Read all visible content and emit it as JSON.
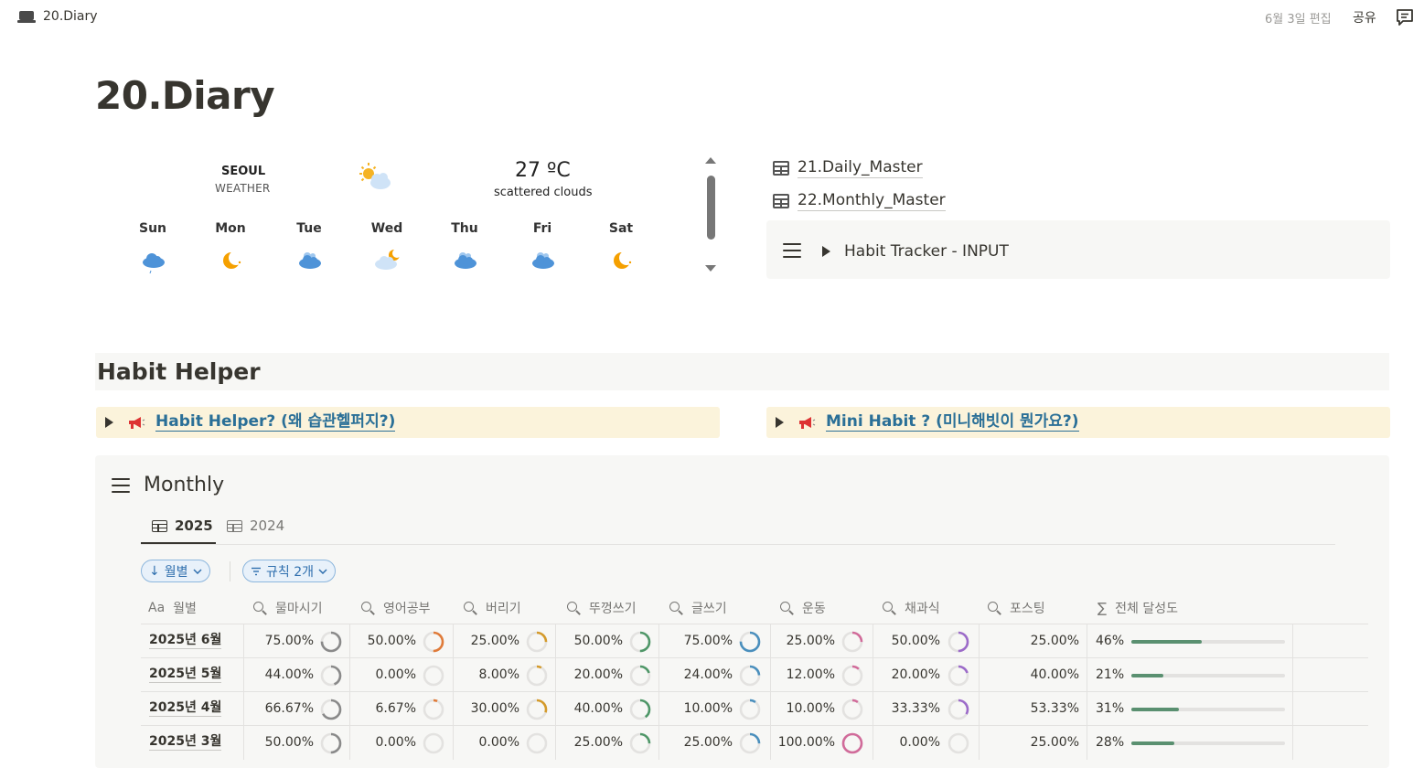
{
  "topbar": {
    "breadcrumb": "20.Diary",
    "edited": "6월 3일 편집",
    "share": "공유"
  },
  "page": {
    "title": "20.Diary"
  },
  "weather": {
    "city": "SEOUL",
    "subtitle": "WEATHER",
    "temp": "27 ºC",
    "desc": "scattered clouds",
    "days": [
      {
        "label": "Sun",
        "icon": "cloud-rain-icon"
      },
      {
        "label": "Mon",
        "icon": "moon-icon"
      },
      {
        "label": "Tue",
        "icon": "cloud-icon"
      },
      {
        "label": "Wed",
        "icon": "cloud-moon-icon"
      },
      {
        "label": "Thu",
        "icon": "cloud-icon"
      },
      {
        "label": "Fri",
        "icon": "cloud-icon"
      },
      {
        "label": "Sat",
        "icon": "moon-icon"
      }
    ]
  },
  "links": {
    "daily": "21.Daily_Master",
    "monthly": "22.Monthly_Master"
  },
  "toggle": {
    "label": "Habit Tracker - INPUT"
  },
  "habit_helper": {
    "heading": "Habit Helper",
    "callout_left": "Habit Helper? (왜 습관헬퍼지?)",
    "callout_right": "Mini Habit ? (미니해빗이 뭔가요?)"
  },
  "monthly": {
    "title": "Monthly",
    "tabs": [
      "2025",
      "2024"
    ],
    "filters": [
      "월별",
      "규칙 2개"
    ],
    "columns": [
      "월별",
      "물마시기",
      "영어공부",
      "버리기",
      "뚜껑쓰기",
      "글쓰기",
      "운동",
      "채과식",
      "포스팅",
      "전체 달성도"
    ],
    "rows": [
      {
        "name": "2025년 6월",
        "vals": [
          "75.00%",
          "50.00%",
          "25.00%",
          "50.00%",
          "75.00%",
          "25.00%",
          "50.00%",
          "25.00%"
        ],
        "fracs": [
          0.75,
          0.5,
          0.25,
          0.5,
          0.75,
          0.25,
          0.5
        ],
        "total": "46%",
        "total_frac": 0.46
      },
      {
        "name": "2025년 5월",
        "vals": [
          "44.00%",
          "0.00%",
          "8.00%",
          "20.00%",
          "24.00%",
          "12.00%",
          "20.00%",
          "40.00%"
        ],
        "fracs": [
          0.44,
          0.0,
          0.08,
          0.2,
          0.24,
          0.12,
          0.2
        ],
        "total": "21%",
        "total_frac": 0.21
      },
      {
        "name": "2025년 4월",
        "vals": [
          "66.67%",
          "6.67%",
          "30.00%",
          "40.00%",
          "10.00%",
          "10.00%",
          "33.33%",
          "53.33%"
        ],
        "fracs": [
          0.6667,
          0.0667,
          0.3,
          0.4,
          0.1,
          0.1,
          0.3333
        ],
        "total": "31%",
        "total_frac": 0.31
      },
      {
        "name": "2025년 3월",
        "vals": [
          "50.00%",
          "0.00%",
          "0.00%",
          "25.00%",
          "25.00%",
          "100.00%",
          "0.00%",
          "25.00%"
        ],
        "fracs": [
          0.5,
          0.0,
          0.0,
          0.25,
          0.25,
          1.0,
          0.0
        ],
        "total": "28%",
        "total_frac": 0.28
      }
    ],
    "ring_colors": [
      "#8a8a8a",
      "#e07b39",
      "#d49a2a",
      "#4f9768",
      "#4a8fbd",
      "#d16b9a",
      "#9c6bc9"
    ],
    "bar_color": "#5a9070"
  }
}
